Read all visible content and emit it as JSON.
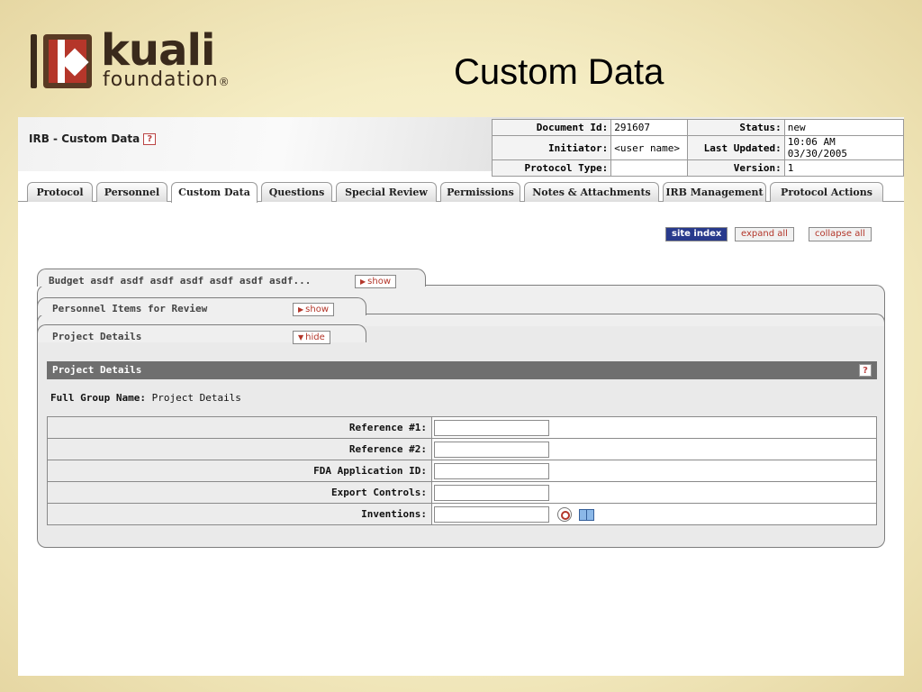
{
  "slide": {
    "title": "Custom Data",
    "logo_word": "kuali",
    "logo_sub": "foundation",
    "logo_reg": "®"
  },
  "header": {
    "doc_title": "IRB - Custom Data",
    "help": "?",
    "fields": {
      "document_id_label": "Document Id:",
      "document_id": "291607",
      "status_label": "Status:",
      "status": "new",
      "initiator_label": "Initiator:",
      "initiator": "<user name>",
      "last_updated_label": "Last Updated:",
      "last_updated": "10:06 AM 03/30/2005",
      "protocol_type_label": "Protocol Type:",
      "protocol_type": "",
      "version_label": "Version:",
      "version": "1"
    }
  },
  "tabs": [
    {
      "label": "Protocol"
    },
    {
      "label": "Personnel"
    },
    {
      "label": "Custom Data"
    },
    {
      "label": "Questions"
    },
    {
      "label": "Special Review"
    },
    {
      "label": "Permissions"
    },
    {
      "label": "Notes & Attachments"
    },
    {
      "label": "IRB Management"
    },
    {
      "label": "Protocol Actions"
    }
  ],
  "active_tab": "Custom Data",
  "actions": {
    "site_index": "site index",
    "expand_all": "expand all",
    "collapse_all": "collapse all"
  },
  "panels": [
    {
      "title": "Budget asdf asdf asdf asdf asdf asdf asdf...",
      "toggle": "show"
    },
    {
      "title": "Personnel Items for Review",
      "toggle": "show"
    },
    {
      "title": "Project Details",
      "toggle": "hide"
    }
  ],
  "section": {
    "title": "Project Details",
    "help": "?",
    "full_group_label": "Full Group Name:",
    "full_group_value": "Project Details"
  },
  "form": {
    "rows": [
      {
        "label": "Reference #1:",
        "value": ""
      },
      {
        "label": "Reference #2:",
        "value": ""
      },
      {
        "label": "FDA Application ID:",
        "value": ""
      },
      {
        "label": "Export Controls:",
        "value": ""
      },
      {
        "label": "Inventions:",
        "value": ""
      }
    ]
  },
  "colors": {
    "site_index_bg": "#283a8c",
    "link_red": "#b3362a",
    "section_bar": "#6f6f6f",
    "slide_bg": "#f5edc4"
  },
  "icons": {
    "lookup": "magnifier-icon",
    "direct_inquiry": "book-icon"
  }
}
